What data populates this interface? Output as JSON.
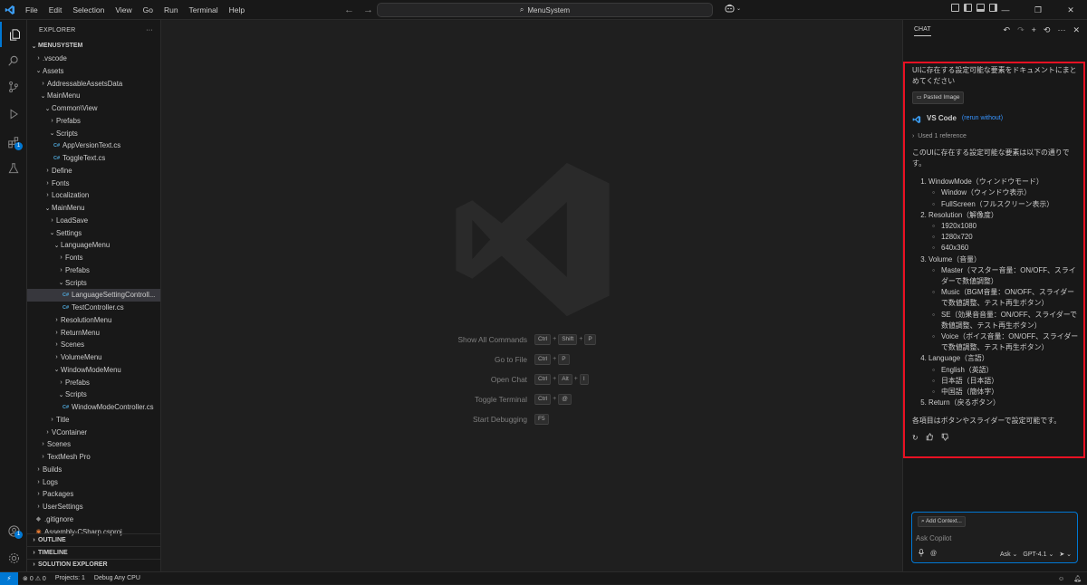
{
  "titlebar": {
    "menu": [
      "File",
      "Edit",
      "Selection",
      "View",
      "Go",
      "Run",
      "Terminal",
      "Help"
    ],
    "search_text": "MenuSystem"
  },
  "activity": {
    "extensions_badge": "1",
    "account_badge": "1"
  },
  "explorer": {
    "title": "EXPLORER",
    "more": "···",
    "tree": [
      {
        "label": "MENUSYSTEM",
        "depth": 0,
        "chev": "down",
        "root": true
      },
      {
        "label": ".vscode",
        "depth": 1,
        "chev": "right"
      },
      {
        "label": "Assets",
        "depth": 1,
        "chev": "down"
      },
      {
        "label": "AddressableAssetsData",
        "depth": 2,
        "chev": "right"
      },
      {
        "label": "MainMenu",
        "depth": 2,
        "chev": "down"
      },
      {
        "label": "Common\\View",
        "depth": 3,
        "chev": "down"
      },
      {
        "label": "Prefabs",
        "depth": 4,
        "chev": "right"
      },
      {
        "label": "Scripts",
        "depth": 4,
        "chev": "down"
      },
      {
        "label": "AppVersionText.cs",
        "depth": 5,
        "icon": "cs"
      },
      {
        "label": "ToggleText.cs",
        "depth": 5,
        "icon": "cs"
      },
      {
        "label": "Define",
        "depth": 3,
        "chev": "right"
      },
      {
        "label": "Fonts",
        "depth": 3,
        "chev": "right"
      },
      {
        "label": "Localization",
        "depth": 3,
        "chev": "right"
      },
      {
        "label": "MainMenu",
        "depth": 3,
        "chev": "down"
      },
      {
        "label": "LoadSave",
        "depth": 4,
        "chev": "right"
      },
      {
        "label": "Settings",
        "depth": 4,
        "chev": "down"
      },
      {
        "label": "LanguageMenu",
        "depth": 5,
        "chev": "down"
      },
      {
        "label": "Fonts",
        "depth": 6,
        "chev": "right"
      },
      {
        "label": "Prefabs",
        "depth": 6,
        "chev": "right"
      },
      {
        "label": "Scripts",
        "depth": 6,
        "chev": "down"
      },
      {
        "label": "LanguageSettingControll...",
        "depth": 7,
        "icon": "cs",
        "selected": true
      },
      {
        "label": "TestController.cs",
        "depth": 7,
        "icon": "cs"
      },
      {
        "label": "ResolutionMenu",
        "depth": 5,
        "chev": "right"
      },
      {
        "label": "ReturnMenu",
        "depth": 5,
        "chev": "right"
      },
      {
        "label": "Scenes",
        "depth": 5,
        "chev": "right"
      },
      {
        "label": "VolumeMenu",
        "depth": 5,
        "chev": "right"
      },
      {
        "label": "WindowModeMenu",
        "depth": 5,
        "chev": "down"
      },
      {
        "label": "Prefabs",
        "depth": 6,
        "chev": "right"
      },
      {
        "label": "Scripts",
        "depth": 6,
        "chev": "down"
      },
      {
        "label": "WindowModeController.cs",
        "depth": 7,
        "icon": "cs"
      },
      {
        "label": "Title",
        "depth": 4,
        "chev": "right"
      },
      {
        "label": "VContainer",
        "depth": 3,
        "chev": "right"
      },
      {
        "label": "Scenes",
        "depth": 2,
        "chev": "right"
      },
      {
        "label": "TextMesh Pro",
        "depth": 2,
        "chev": "right"
      },
      {
        "label": "Builds",
        "depth": 1,
        "chev": "right"
      },
      {
        "label": "Logs",
        "depth": 1,
        "chev": "right"
      },
      {
        "label": "Packages",
        "depth": 1,
        "chev": "right"
      },
      {
        "label": "UserSettings",
        "depth": 1,
        "chev": "right"
      },
      {
        "label": ".gitignore",
        "depth": 1,
        "icon": "git"
      },
      {
        "label": "Assembly-CSharp.csproj",
        "depth": 1,
        "icon": "rss"
      }
    ],
    "sections": [
      "OUTLINE",
      "TIMELINE",
      "SOLUTION EXPLORER"
    ]
  },
  "editor": {
    "shortcuts": [
      {
        "label": "Show All Commands",
        "keys": [
          "Ctrl",
          "Shift",
          "P"
        ]
      },
      {
        "label": "Go to File",
        "keys": [
          "Ctrl",
          "P"
        ]
      },
      {
        "label": "Open Chat",
        "keys": [
          "Ctrl",
          "Alt",
          "I"
        ]
      },
      {
        "label": "Toggle Terminal",
        "keys": [
          "Ctrl",
          "@"
        ]
      },
      {
        "label": "Start Debugging",
        "keys": [
          "F5"
        ]
      }
    ]
  },
  "chat": {
    "tab": "CHAT",
    "user_message": "UIに存在する設定可能な要素をドキュメントにまとめてください",
    "attachment": "Pasted Image",
    "responder": "VS Code",
    "rerun": "(rerun without)",
    "used_ref": "Used 1 reference",
    "intro": "このUIに存在する設定可能な要素は以下の通りです。",
    "items": [
      {
        "title": "WindowMode（ウィンドウモード）",
        "subs": [
          "Window（ウィンドウ表示）",
          "FullScreen（フルスクリーン表示）"
        ]
      },
      {
        "title": "Resolution（解像度）",
        "subs": [
          "1920x1080",
          "1280x720",
          "640x360"
        ]
      },
      {
        "title": "Volume（音量）",
        "subs": [
          "Master（マスター音量：ON/OFF、スライダーで数値調整）",
          "Music（BGM音量：ON/OFF、スライダーで数値調整、テスト再生ボタン）",
          "SE（効果音音量：ON/OFF、スライダーで数値調整、テスト再生ボタン）",
          "Voice（ボイス音量：ON/OFF、スライダーで数値調整、テスト再生ボタン）"
        ]
      },
      {
        "title": "Language（言語）",
        "subs": [
          "English（英語）",
          "日本語（日本語）",
          "中国語（簡体字）"
        ]
      },
      {
        "title": "Return（戻るボタン）",
        "subs": []
      }
    ],
    "closing": "各項目はボタンやスライダーで設定可能です。",
    "input": {
      "add_context": "Add Context...",
      "placeholder": "Ask Copilot",
      "mode": "Ask",
      "model": "GPT-4.1"
    }
  },
  "status": {
    "errors": "0",
    "warnings": "0",
    "projects": "Projects: 1",
    "debug": "Debug Any CPU"
  },
  "colors": {
    "accent": "#0078d4",
    "highlight_box": "#e81123"
  }
}
